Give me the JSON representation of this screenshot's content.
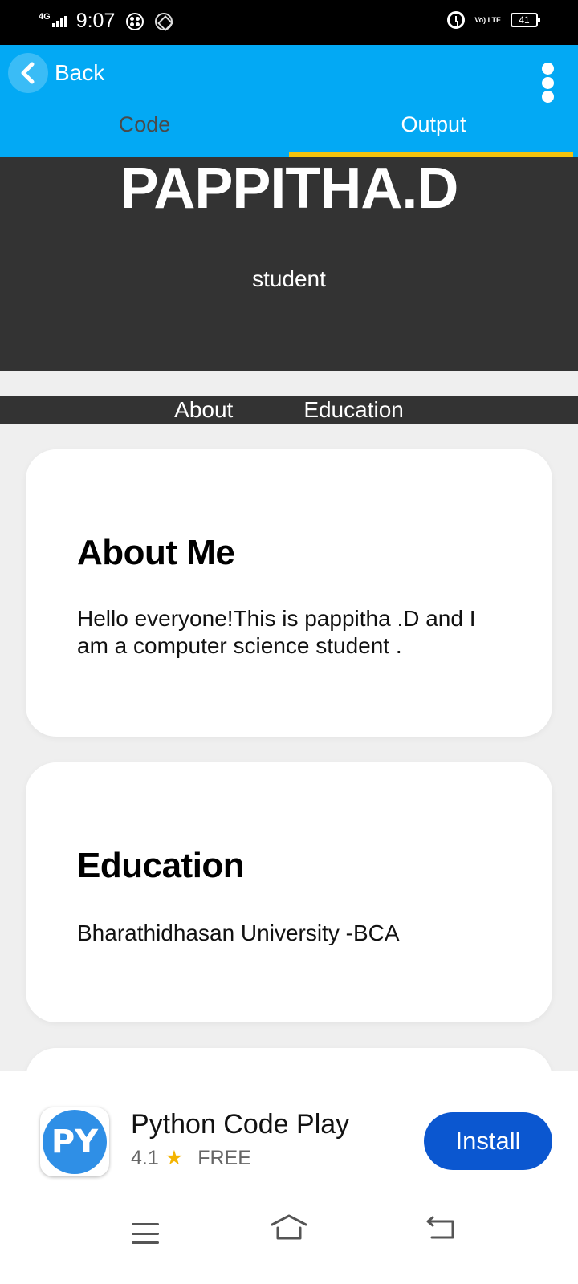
{
  "status_bar": {
    "network": "4G",
    "time": "9:07",
    "volte": "Vo) LTE",
    "battery": "41"
  },
  "app_bar": {
    "back_label": "Back",
    "tabs": [
      {
        "label": "Code",
        "active": false
      },
      {
        "label": "Output",
        "active": true
      }
    ],
    "accent_color": "#03a9f4",
    "tab_indicator_color": "#f4c20d"
  },
  "hero": {
    "name": "PAPPITHA.D",
    "role": "student"
  },
  "nav": {
    "items": [
      "About",
      "Education"
    ]
  },
  "sections": {
    "about": {
      "heading": "About Me",
      "text": "Hello everyone!This is pappitha .D and I am a computer science student ."
    },
    "education": {
      "heading": "Education",
      "text": "Bharathidhasan University -BCA"
    }
  },
  "ad": {
    "app_name": "Python Code Play",
    "logo_text": "PY",
    "rating": "4.1",
    "price": "FREE",
    "install_label": "Install",
    "install_color": "#0b57d0"
  }
}
